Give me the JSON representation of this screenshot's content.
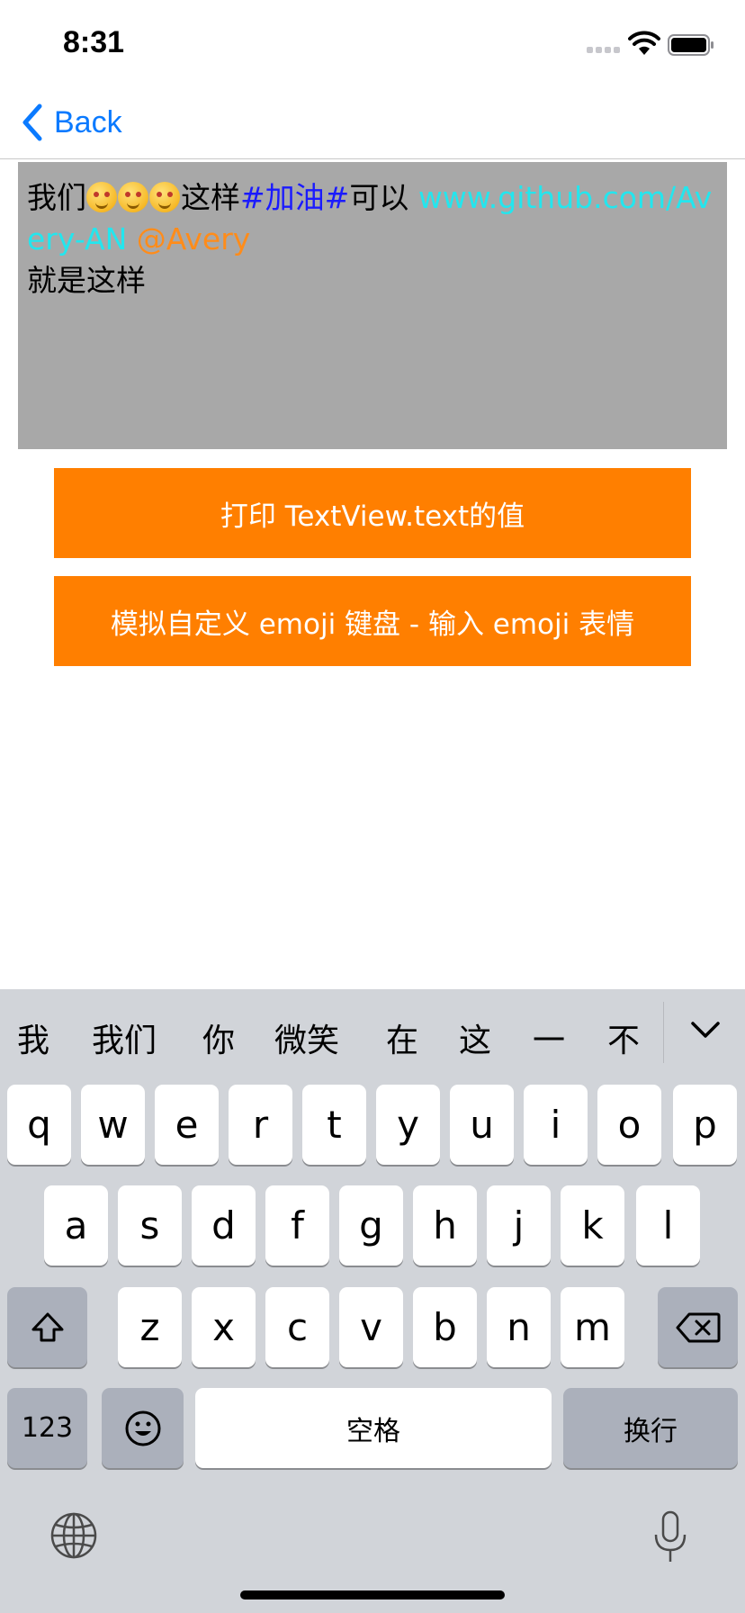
{
  "status_bar": {
    "time": "8:31"
  },
  "nav": {
    "back_label": "Back"
  },
  "text_view": {
    "segments": {
      "prefix": "我们",
      "middle": "这样",
      "topic": "#加油#",
      "after_topic": "可以 ",
      "link": "www.github.com/Avery-AN",
      "space": " ",
      "mention": "@Avery",
      "second_line": "就是这样"
    },
    "colors": {
      "topic": "#1a1aff",
      "link": "#23e6ee",
      "mention": "#ff8c1a"
    }
  },
  "buttons": {
    "print_text": "打印 TextView.text的值",
    "emoji_keyboard": "模拟自定义 emoji 键盘 - 输入 emoji 表情"
  },
  "keyboard": {
    "candidates": [
      "我",
      "我们",
      "你",
      "微笑",
      "在",
      "这",
      "一",
      "不"
    ],
    "rows": [
      [
        "q",
        "w",
        "e",
        "r",
        "t",
        "y",
        "u",
        "i",
        "o",
        "p"
      ],
      [
        "a",
        "s",
        "d",
        "f",
        "g",
        "h",
        "j",
        "k",
        "l"
      ],
      [
        "z",
        "x",
        "c",
        "v",
        "b",
        "n",
        "m"
      ]
    ],
    "numbers_label": "123",
    "space_label": "空格",
    "return_label": "换行"
  },
  "colors": {
    "accent_orange": "#ff7f00",
    "ios_blue": "#0a7aff",
    "text_view_bg": "#a8a8a8"
  }
}
